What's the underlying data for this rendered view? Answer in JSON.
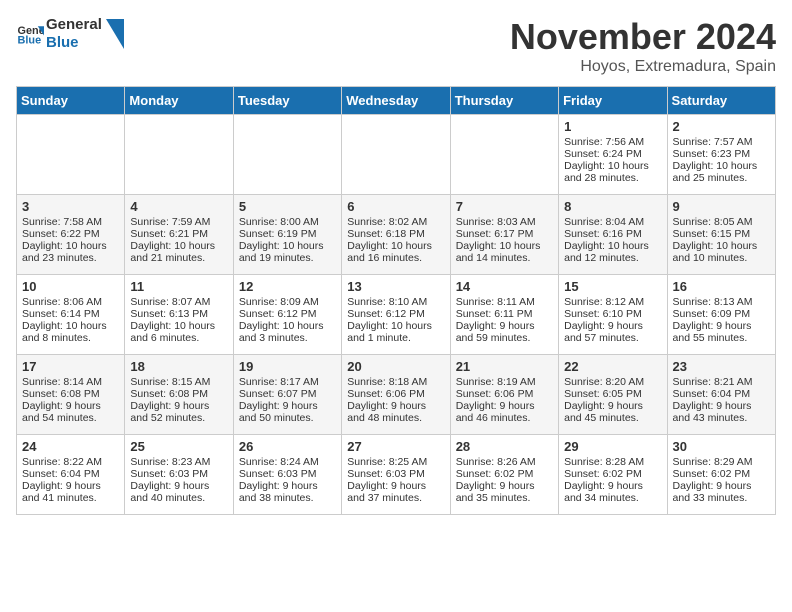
{
  "logo": {
    "line1": "General",
    "line2": "Blue"
  },
  "title": "November 2024",
  "location": "Hoyos, Extremadura, Spain",
  "days_of_week": [
    "Sunday",
    "Monday",
    "Tuesday",
    "Wednesday",
    "Thursday",
    "Friday",
    "Saturday"
  ],
  "weeks": [
    [
      {
        "day": "",
        "sunrise": "",
        "sunset": "",
        "daylight": ""
      },
      {
        "day": "",
        "sunrise": "",
        "sunset": "",
        "daylight": ""
      },
      {
        "day": "",
        "sunrise": "",
        "sunset": "",
        "daylight": ""
      },
      {
        "day": "",
        "sunrise": "",
        "sunset": "",
        "daylight": ""
      },
      {
        "day": "",
        "sunrise": "",
        "sunset": "",
        "daylight": ""
      },
      {
        "day": "1",
        "sunrise": "Sunrise: 7:56 AM",
        "sunset": "Sunset: 6:24 PM",
        "daylight": "Daylight: 10 hours and 28 minutes."
      },
      {
        "day": "2",
        "sunrise": "Sunrise: 7:57 AM",
        "sunset": "Sunset: 6:23 PM",
        "daylight": "Daylight: 10 hours and 25 minutes."
      }
    ],
    [
      {
        "day": "3",
        "sunrise": "Sunrise: 7:58 AM",
        "sunset": "Sunset: 6:22 PM",
        "daylight": "Daylight: 10 hours and 23 minutes."
      },
      {
        "day": "4",
        "sunrise": "Sunrise: 7:59 AM",
        "sunset": "Sunset: 6:21 PM",
        "daylight": "Daylight: 10 hours and 21 minutes."
      },
      {
        "day": "5",
        "sunrise": "Sunrise: 8:00 AM",
        "sunset": "Sunset: 6:19 PM",
        "daylight": "Daylight: 10 hours and 19 minutes."
      },
      {
        "day": "6",
        "sunrise": "Sunrise: 8:02 AM",
        "sunset": "Sunset: 6:18 PM",
        "daylight": "Daylight: 10 hours and 16 minutes."
      },
      {
        "day": "7",
        "sunrise": "Sunrise: 8:03 AM",
        "sunset": "Sunset: 6:17 PM",
        "daylight": "Daylight: 10 hours and 14 minutes."
      },
      {
        "day": "8",
        "sunrise": "Sunrise: 8:04 AM",
        "sunset": "Sunset: 6:16 PM",
        "daylight": "Daylight: 10 hours and 12 minutes."
      },
      {
        "day": "9",
        "sunrise": "Sunrise: 8:05 AM",
        "sunset": "Sunset: 6:15 PM",
        "daylight": "Daylight: 10 hours and 10 minutes."
      }
    ],
    [
      {
        "day": "10",
        "sunrise": "Sunrise: 8:06 AM",
        "sunset": "Sunset: 6:14 PM",
        "daylight": "Daylight: 10 hours and 8 minutes."
      },
      {
        "day": "11",
        "sunrise": "Sunrise: 8:07 AM",
        "sunset": "Sunset: 6:13 PM",
        "daylight": "Daylight: 10 hours and 6 minutes."
      },
      {
        "day": "12",
        "sunrise": "Sunrise: 8:09 AM",
        "sunset": "Sunset: 6:12 PM",
        "daylight": "Daylight: 10 hours and 3 minutes."
      },
      {
        "day": "13",
        "sunrise": "Sunrise: 8:10 AM",
        "sunset": "Sunset: 6:12 PM",
        "daylight": "Daylight: 10 hours and 1 minute."
      },
      {
        "day": "14",
        "sunrise": "Sunrise: 8:11 AM",
        "sunset": "Sunset: 6:11 PM",
        "daylight": "Daylight: 9 hours and 59 minutes."
      },
      {
        "day": "15",
        "sunrise": "Sunrise: 8:12 AM",
        "sunset": "Sunset: 6:10 PM",
        "daylight": "Daylight: 9 hours and 57 minutes."
      },
      {
        "day": "16",
        "sunrise": "Sunrise: 8:13 AM",
        "sunset": "Sunset: 6:09 PM",
        "daylight": "Daylight: 9 hours and 55 minutes."
      }
    ],
    [
      {
        "day": "17",
        "sunrise": "Sunrise: 8:14 AM",
        "sunset": "Sunset: 6:08 PM",
        "daylight": "Daylight: 9 hours and 54 minutes."
      },
      {
        "day": "18",
        "sunrise": "Sunrise: 8:15 AM",
        "sunset": "Sunset: 6:08 PM",
        "daylight": "Daylight: 9 hours and 52 minutes."
      },
      {
        "day": "19",
        "sunrise": "Sunrise: 8:17 AM",
        "sunset": "Sunset: 6:07 PM",
        "daylight": "Daylight: 9 hours and 50 minutes."
      },
      {
        "day": "20",
        "sunrise": "Sunrise: 8:18 AM",
        "sunset": "Sunset: 6:06 PM",
        "daylight": "Daylight: 9 hours and 48 minutes."
      },
      {
        "day": "21",
        "sunrise": "Sunrise: 8:19 AM",
        "sunset": "Sunset: 6:06 PM",
        "daylight": "Daylight: 9 hours and 46 minutes."
      },
      {
        "day": "22",
        "sunrise": "Sunrise: 8:20 AM",
        "sunset": "Sunset: 6:05 PM",
        "daylight": "Daylight: 9 hours and 45 minutes."
      },
      {
        "day": "23",
        "sunrise": "Sunrise: 8:21 AM",
        "sunset": "Sunset: 6:04 PM",
        "daylight": "Daylight: 9 hours and 43 minutes."
      }
    ],
    [
      {
        "day": "24",
        "sunrise": "Sunrise: 8:22 AM",
        "sunset": "Sunset: 6:04 PM",
        "daylight": "Daylight: 9 hours and 41 minutes."
      },
      {
        "day": "25",
        "sunrise": "Sunrise: 8:23 AM",
        "sunset": "Sunset: 6:03 PM",
        "daylight": "Daylight: 9 hours and 40 minutes."
      },
      {
        "day": "26",
        "sunrise": "Sunrise: 8:24 AM",
        "sunset": "Sunset: 6:03 PM",
        "daylight": "Daylight: 9 hours and 38 minutes."
      },
      {
        "day": "27",
        "sunrise": "Sunrise: 8:25 AM",
        "sunset": "Sunset: 6:03 PM",
        "daylight": "Daylight: 9 hours and 37 minutes."
      },
      {
        "day": "28",
        "sunrise": "Sunrise: 8:26 AM",
        "sunset": "Sunset: 6:02 PM",
        "daylight": "Daylight: 9 hours and 35 minutes."
      },
      {
        "day": "29",
        "sunrise": "Sunrise: 8:28 AM",
        "sunset": "Sunset: 6:02 PM",
        "daylight": "Daylight: 9 hours and 34 minutes."
      },
      {
        "day": "30",
        "sunrise": "Sunrise: 8:29 AM",
        "sunset": "Sunset: 6:02 PM",
        "daylight": "Daylight: 9 hours and 33 minutes."
      }
    ]
  ]
}
